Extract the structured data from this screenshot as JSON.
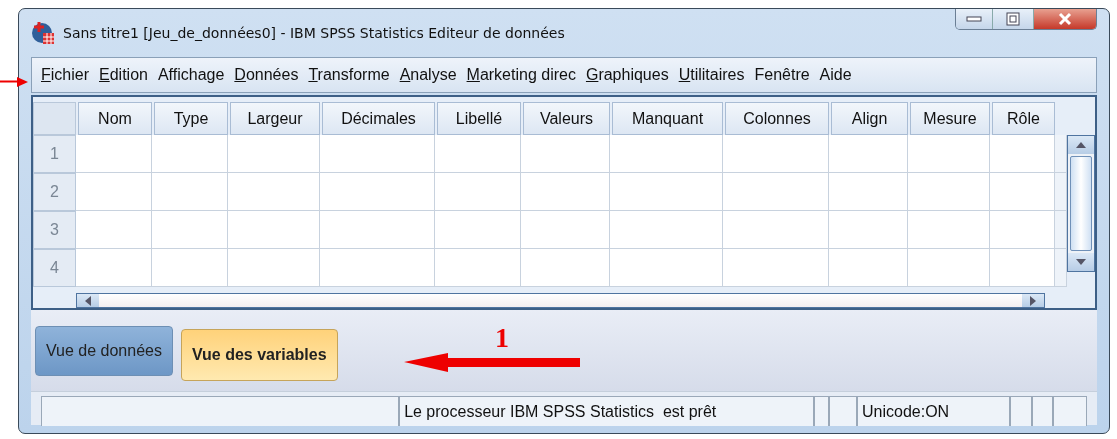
{
  "window": {
    "title": "Sans titre1 [Jeu_de_données0] - IBM SPSS Statistics Editeur de données"
  },
  "menu": [
    {
      "label": "Fichier",
      "mnemonic": true
    },
    {
      "label": "Edition",
      "mnemonic": true
    },
    {
      "label": "Affichage",
      "mnemonic": false
    },
    {
      "label": "Données",
      "mnemonic": true
    },
    {
      "label": "Transforme",
      "mnemonic": true
    },
    {
      "label": "Analyse",
      "mnemonic": true
    },
    {
      "label": "Marketing direc",
      "mnemonic": true
    },
    {
      "label": "Graphiques",
      "mnemonic": true
    },
    {
      "label": "Utilitaires",
      "mnemonic": true
    },
    {
      "label": "Fenêtre",
      "mnemonic": false
    },
    {
      "label": "Aide",
      "mnemonic": false
    }
  ],
  "grid": {
    "columns": [
      "Nom",
      "Type",
      "Largeur",
      "Décimales",
      "Libellé",
      "Valeurs",
      "Manquant",
      "Colonnes",
      "Align",
      "Mesure",
      "Rôle"
    ],
    "rows": [
      "1",
      "2",
      "3",
      "4"
    ]
  },
  "tabs": [
    {
      "label": "Vue de données",
      "selected": false
    },
    {
      "label": "Vue des variables",
      "selected": true
    }
  ],
  "status_bar": {
    "message": "Le processeur IBM SPSS Statistics  est prêt",
    "encoding": "Unicode:ON"
  },
  "annotation": {
    "label": "1"
  }
}
